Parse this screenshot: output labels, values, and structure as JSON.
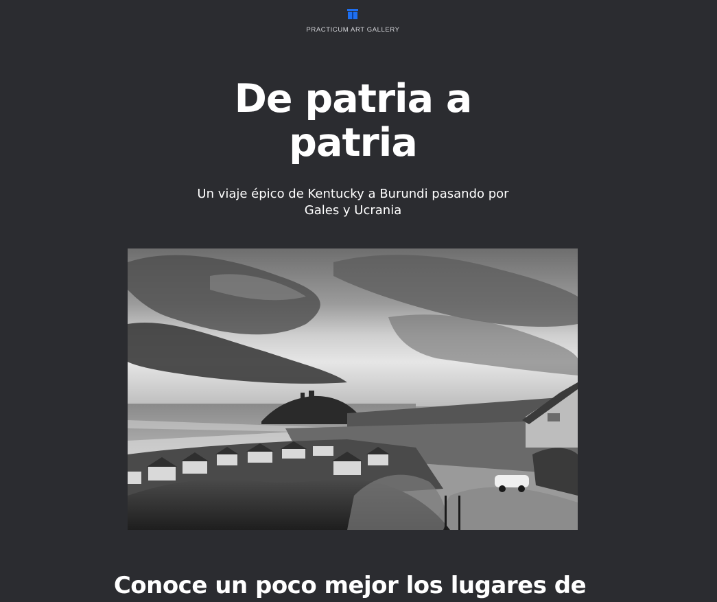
{
  "header": {
    "brand": "PRACTICUM ART GALLERY",
    "logo_icon": "gallery-logo-icon",
    "accent_color": "#1e6ff0"
  },
  "hero": {
    "title": "De patria a patria",
    "subtitle": "Un viaje épico de Kentucky a Burundi pasando por Gales y Ucrania",
    "image": "grayscale-coastal-town-photo"
  },
  "main": {
    "section_title": "Conoce un poco mejor los lugares de"
  },
  "colors": {
    "background": "#2b2c30",
    "text": "#ffffff"
  }
}
